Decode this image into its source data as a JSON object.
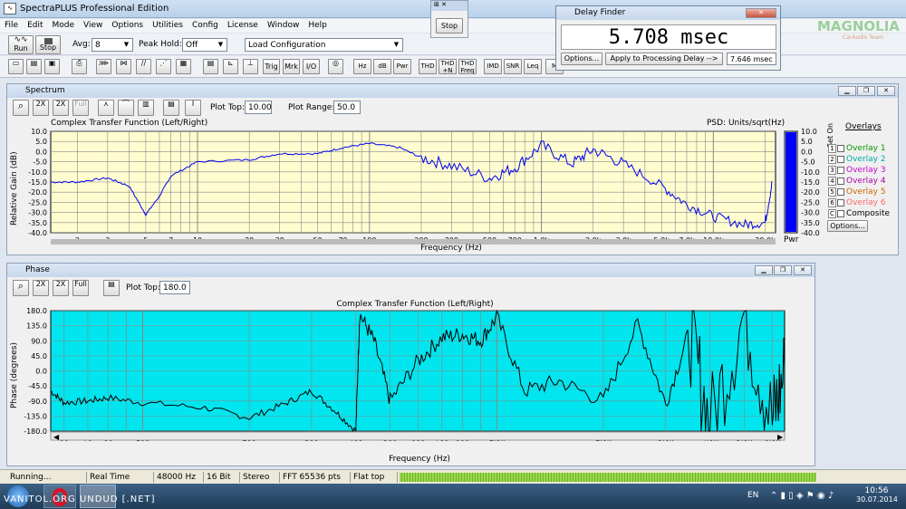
{
  "app": {
    "title": "SpectraPLUS Professional Edition",
    "icon_text": "∿"
  },
  "menu": [
    "File",
    "Edit",
    "Mode",
    "View",
    "Options",
    "Utilities",
    "Config",
    "License",
    "Window",
    "Help"
  ],
  "toolbar": {
    "run": "Run",
    "stop": "Stop",
    "avg_label": "Avg:",
    "avg_value": "8",
    "peak_hold_label": "Peak Hold:",
    "peak_hold_value": "Off",
    "load_config": "Load Configuration",
    "buttons2": [
      "Hz",
      "dB",
      "Pwr",
      "THD",
      "THD +N",
      "THD Freq",
      "IMD",
      "SNR",
      "Leq",
      "M"
    ],
    "analysis_buttons": [
      "Trig",
      "Mrk",
      "I/O"
    ]
  },
  "stop_window": {
    "title": "Stop",
    "button": "Stop"
  },
  "delay_finder": {
    "title": "Delay Finder",
    "value": "5.708 msec",
    "options": "Options...",
    "apply": "Apply to Processing Delay -->",
    "field_value": "7.646",
    "field_unit": "msec"
  },
  "watermark": {
    "line1": "MAGNOLIA",
    "line2": "CarAudio Team"
  },
  "spectrum": {
    "title": "Spectrum",
    "plot_top_label": "Plot Top:",
    "plot_top_value": "10.00",
    "plot_range_label": "Plot Range:",
    "plot_range_value": "50.0",
    "chart_title": "Complex Transfer Function (Left/Right)",
    "psd_label": "PSD: Units/sqrt(Hz)",
    "ylabel": "Relative Gain (dB)",
    "xlabel": "Frequency (Hz)",
    "yticks": [
      "10.0",
      "5.0",
      "0.0",
      "-5.0",
      "-10.0",
      "-15.0",
      "-20.0",
      "-25.0",
      "-30.0",
      "-35.0",
      "-40.0"
    ],
    "xticks": [
      "2",
      "3",
      "5",
      "7",
      "10",
      "20",
      "30",
      "50",
      "70",
      "100",
      "200",
      "300",
      "500",
      "700",
      "1.0k",
      "2.0k",
      "3.0k",
      "5.0k",
      "7.0k",
      "10.0k",
      "20.0k"
    ],
    "bar_label": "Pwr",
    "overlays_title": "Overlays",
    "set_label": "Set",
    "on_label": "On",
    "overlays": [
      {
        "num": "1",
        "name": "Overlay 1",
        "color": "#009900"
      },
      {
        "num": "2",
        "name": "Overlay 2",
        "color": "#00aaaa"
      },
      {
        "num": "3",
        "name": "Overlay 3",
        "color": "#cc00cc"
      },
      {
        "num": "4",
        "name": "Overlay 4",
        "color": "#aa00aa"
      },
      {
        "num": "5",
        "name": "Overlay 5",
        "color": "#cc6600"
      },
      {
        "num": "6",
        "name": "Overlay 6",
        "color": "#ff6666"
      },
      {
        "num": "C",
        "name": "Composite",
        "color": "#000000"
      }
    ],
    "overlay_options": "Options..."
  },
  "phase": {
    "title": "Phase",
    "plot_top_label": "Plot Top:",
    "plot_top_value": "180.0",
    "chart_title": "Complex Transfer Function (Left/Right)",
    "ylabel": "Phase (degrees)",
    "xlabel": "Frequency (Hz)",
    "yticks": [
      "180.0",
      "135.0",
      "90.0",
      "45.0",
      "0.0",
      "-45.0",
      "-90.0",
      "-135.0",
      "-180.0"
    ],
    "xticks": [
      "60",
      "70",
      "80",
      "100",
      "200",
      "300",
      "400",
      "500",
      "600",
      "700",
      "800",
      "1.0k",
      "2.0k",
      "3.0k",
      "4.0k",
      "5.0k",
      "6.0k"
    ]
  },
  "status": {
    "state": "Running...",
    "mode": "Real Time",
    "rate": "48000 Hz",
    "bits": "16 Bit",
    "channels": "Stereo",
    "fft": "FFT 65536 pts",
    "window": "Flat top"
  },
  "taskbar": {
    "lang": "EN",
    "time": "10:56",
    "date": "30.07.2014",
    "credit": "VANITOL.ORG  UNDUD [.NET]"
  },
  "colors": {
    "spectrum_bg": "#fffdd0",
    "phase_bg": "#00e5ee",
    "trace_spectrum": "#0000ee",
    "trace_phase": "#000000",
    "pwr_bar": "#0000ff"
  },
  "chart_data": [
    {
      "type": "line",
      "title": "Complex Transfer Function (Left/Right)",
      "xlabel": "Frequency (Hz)",
      "ylabel": "Relative Gain (dB)",
      "xscale": "log",
      "xlim": [
        1.4,
        23000
      ],
      "ylim": [
        -40,
        10
      ],
      "grid": true,
      "x": [
        1.4,
        2,
        3,
        4,
        5,
        6,
        7,
        10,
        20,
        30,
        50,
        70,
        100,
        150,
        200,
        300,
        500,
        700,
        1000,
        1500,
        2000,
        3000,
        5000,
        7000,
        10000,
        15000,
        20000,
        22000
      ],
      "y": [
        -15,
        -15,
        -13,
        -17,
        -31,
        -22,
        -12,
        -5,
        -4,
        -1,
        -1,
        2,
        4,
        2,
        -3,
        -7,
        -13,
        -8,
        3,
        -6,
        1,
        -6,
        -17,
        -26,
        -32,
        -36,
        -35,
        -15
      ]
    },
    {
      "type": "line",
      "title": "Complex Transfer Function (Left/Right)",
      "xlabel": "Frequency (Hz)",
      "ylabel": "Phase (degrees)",
      "xscale": "log",
      "xlim": [
        55,
        6500
      ],
      "ylim": [
        -180,
        180
      ],
      "grid": true,
      "x": [
        55,
        60,
        70,
        80,
        100,
        150,
        200,
        250,
        300,
        350,
        400,
        410,
        450,
        500,
        600,
        700,
        800,
        900,
        1000,
        1200,
        1500,
        2000,
        2500,
        3000,
        3500,
        4000,
        5000,
        6000,
        6500
      ],
      "y": [
        -60,
        -95,
        -90,
        -80,
        -95,
        -110,
        -140,
        -100,
        -60,
        -120,
        -180,
        170,
        90,
        -90,
        30,
        100,
        110,
        90,
        160,
        -60,
        -30,
        -90,
        140,
        -100,
        120,
        -160,
        170,
        -150,
        0
      ]
    }
  ]
}
